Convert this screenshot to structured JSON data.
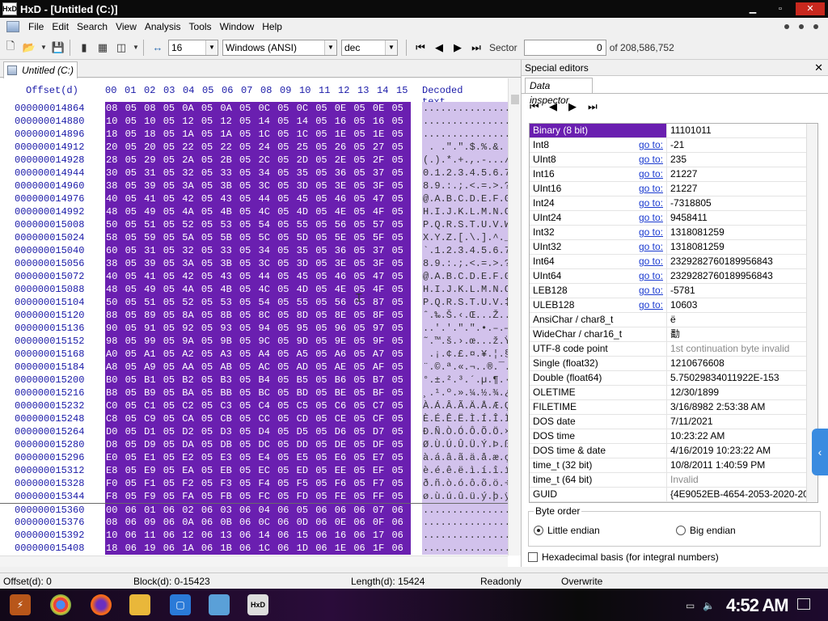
{
  "window": {
    "title": "HxD - [Untitled (C:)]",
    "app_icon_text": "HxD"
  },
  "menu": [
    "File",
    "Edit",
    "Search",
    "View",
    "Analysis",
    "Tools",
    "Window",
    "Help"
  ],
  "toolbar": {
    "bytes_per_row": "16",
    "charset": "Windows (ANSI)",
    "offset_base": "dec",
    "sector_label": "Sector",
    "sector_value": "0",
    "sector_total": "of 208,586,752"
  },
  "document_tab": "Untitled (C:)",
  "hex_header": {
    "offset": "Offset(d)",
    "columns": [
      "00",
      "01",
      "02",
      "03",
      "04",
      "05",
      "06",
      "07",
      "08",
      "09",
      "10",
      "11",
      "12",
      "13",
      "14",
      "15"
    ],
    "decoded": "Decoded text"
  },
  "hex_rows": [
    {
      "offset": "000000014864",
      "bytes": [
        "08",
        "05",
        "08",
        "05",
        "0A",
        "05",
        "0A",
        "05",
        "0C",
        "05",
        "0C",
        "05",
        "0E",
        "05",
        "0E",
        "05"
      ],
      "text": "................"
    },
    {
      "offset": "000000014880",
      "bytes": [
        "10",
        "05",
        "10",
        "05",
        "12",
        "05",
        "12",
        "05",
        "14",
        "05",
        "14",
        "05",
        "16",
        "05",
        "16",
        "05"
      ],
      "text": "................"
    },
    {
      "offset": "000000014896",
      "bytes": [
        "18",
        "05",
        "18",
        "05",
        "1A",
        "05",
        "1A",
        "05",
        "1C",
        "05",
        "1C",
        "05",
        "1E",
        "05",
        "1E",
        "05"
      ],
      "text": "................"
    },
    {
      "offset": "000000014912",
      "bytes": [
        "20",
        "05",
        "20",
        "05",
        "22",
        "05",
        "22",
        "05",
        "24",
        "05",
        "25",
        "05",
        "26",
        "05",
        "27",
        "05"
      ],
      "text": " . .\".\".$.%.&."
    },
    {
      "offset": "000000014928",
      "bytes": [
        "28",
        "05",
        "29",
        "05",
        "2A",
        "05",
        "2B",
        "05",
        "2C",
        "05",
        "2D",
        "05",
        "2E",
        "05",
        "2F",
        "05"
      ],
      "text": "(.).*.+.,.-.../."
    },
    {
      "offset": "000000014944",
      "bytes": [
        "30",
        "05",
        "31",
        "05",
        "32",
        "05",
        "33",
        "05",
        "34",
        "05",
        "35",
        "05",
        "36",
        "05",
        "37",
        "05"
      ],
      "text": "0.1.2.3.4.5.6.7."
    },
    {
      "offset": "000000014960",
      "bytes": [
        "38",
        "05",
        "39",
        "05",
        "3A",
        "05",
        "3B",
        "05",
        "3C",
        "05",
        "3D",
        "05",
        "3E",
        "05",
        "3F",
        "05"
      ],
      "text": "8.9.:.;.<.=.>.?."
    },
    {
      "offset": "000000014976",
      "bytes": [
        "40",
        "05",
        "41",
        "05",
        "42",
        "05",
        "43",
        "05",
        "44",
        "05",
        "45",
        "05",
        "46",
        "05",
        "47",
        "05"
      ],
      "text": "@.A.B.C.D.E.F.G."
    },
    {
      "offset": "000000014992",
      "bytes": [
        "48",
        "05",
        "49",
        "05",
        "4A",
        "05",
        "4B",
        "05",
        "4C",
        "05",
        "4D",
        "05",
        "4E",
        "05",
        "4F",
        "05"
      ],
      "text": "H.I.J.K.L.M.N.O."
    },
    {
      "offset": "000000015008",
      "bytes": [
        "50",
        "05",
        "51",
        "05",
        "52",
        "05",
        "53",
        "05",
        "54",
        "05",
        "55",
        "05",
        "56",
        "05",
        "57",
        "05"
      ],
      "text": "P.Q.R.S.T.U.V.W."
    },
    {
      "offset": "000000015024",
      "bytes": [
        "58",
        "05",
        "59",
        "05",
        "5A",
        "05",
        "5B",
        "05",
        "5C",
        "05",
        "5D",
        "05",
        "5E",
        "05",
        "5F",
        "05"
      ],
      "text": "X.Y.Z.[.\\.].^._."
    },
    {
      "offset": "000000015040",
      "bytes": [
        "60",
        "05",
        "31",
        "05",
        "32",
        "05",
        "33",
        "05",
        "34",
        "05",
        "35",
        "05",
        "36",
        "05",
        "37",
        "05"
      ],
      "text": "`.1.2.3.4.5.6.7."
    },
    {
      "offset": "000000015056",
      "bytes": [
        "38",
        "05",
        "39",
        "05",
        "3A",
        "05",
        "3B",
        "05",
        "3C",
        "05",
        "3D",
        "05",
        "3E",
        "05",
        "3F",
        "05"
      ],
      "text": "8.9.:.;.<.=.>.?."
    },
    {
      "offset": "000000015072",
      "bytes": [
        "40",
        "05",
        "41",
        "05",
        "42",
        "05",
        "43",
        "05",
        "44",
        "05",
        "45",
        "05",
        "46",
        "05",
        "47",
        "05"
      ],
      "text": "@.A.B.C.D.E.F.G."
    },
    {
      "offset": "000000015088",
      "bytes": [
        "48",
        "05",
        "49",
        "05",
        "4A",
        "05",
        "4B",
        "05",
        "4C",
        "05",
        "4D",
        "05",
        "4E",
        "05",
        "4F",
        "05"
      ],
      "text": "H.I.J.K.L.M.N.O."
    },
    {
      "offset": "000000015104",
      "bytes": [
        "50",
        "05",
        "51",
        "05",
        "52",
        "05",
        "53",
        "05",
        "54",
        "05",
        "55",
        "05",
        "56",
        "05",
        "87",
        "05"
      ],
      "text": "P.Q.R.S.T.U.V.‡."
    },
    {
      "offset": "000000015120",
      "bytes": [
        "88",
        "05",
        "89",
        "05",
        "8A",
        "05",
        "8B",
        "05",
        "8C",
        "05",
        "8D",
        "05",
        "8E",
        "05",
        "8F",
        "05"
      ],
      "text": "ˆ.‰.Š.‹.Œ...Ž..."
    },
    {
      "offset": "000000015136",
      "bytes": [
        "90",
        "05",
        "91",
        "05",
        "92",
        "05",
        "93",
        "05",
        "94",
        "05",
        "95",
        "05",
        "96",
        "05",
        "97",
        "05"
      ],
      "text": "..'.'.\".\".•.–.—."
    },
    {
      "offset": "000000015152",
      "bytes": [
        "98",
        "05",
        "99",
        "05",
        "9A",
        "05",
        "9B",
        "05",
        "9C",
        "05",
        "9D",
        "05",
        "9E",
        "05",
        "9F",
        "05"
      ],
      "text": "˜.™.š.›.œ...ž.Ÿ."
    },
    {
      "offset": "000000015168",
      "bytes": [
        "A0",
        "05",
        "A1",
        "05",
        "A2",
        "05",
        "A3",
        "05",
        "A4",
        "05",
        "A5",
        "05",
        "A6",
        "05",
        "A7",
        "05"
      ],
      "text": " .¡.¢.£.¤.¥.¦.§."
    },
    {
      "offset": "000000015184",
      "bytes": [
        "A8",
        "05",
        "A9",
        "05",
        "AA",
        "05",
        "AB",
        "05",
        "AC",
        "05",
        "AD",
        "05",
        "AE",
        "05",
        "AF",
        "05"
      ],
      "text": "¨.©.ª.«.¬.­.®.¯."
    },
    {
      "offset": "000000015200",
      "bytes": [
        "B0",
        "05",
        "B1",
        "05",
        "B2",
        "05",
        "B3",
        "05",
        "B4",
        "05",
        "B5",
        "05",
        "B6",
        "05",
        "B7",
        "05"
      ],
      "text": "°.±.².³.´.µ.¶.·."
    },
    {
      "offset": "000000015216",
      "bytes": [
        "B8",
        "05",
        "B9",
        "05",
        "BA",
        "05",
        "BB",
        "05",
        "BC",
        "05",
        "BD",
        "05",
        "BE",
        "05",
        "BF",
        "05"
      ],
      "text": "¸.¹.º.».¼.½.¾.¿."
    },
    {
      "offset": "000000015232",
      "bytes": [
        "C0",
        "05",
        "C1",
        "05",
        "C2",
        "05",
        "C3",
        "05",
        "C4",
        "05",
        "C5",
        "05",
        "C6",
        "05",
        "C7",
        "05"
      ],
      "text": "À.Á.Â.Ã.Ä.Å.Æ.Ç."
    },
    {
      "offset": "000000015248",
      "bytes": [
        "C8",
        "05",
        "C9",
        "05",
        "CA",
        "05",
        "CB",
        "05",
        "CC",
        "05",
        "CD",
        "05",
        "CE",
        "05",
        "CF",
        "05"
      ],
      "text": "È.É.Ê.Ë.Ì.Í.Î.Ï."
    },
    {
      "offset": "000000015264",
      "bytes": [
        "D0",
        "05",
        "D1",
        "05",
        "D2",
        "05",
        "D3",
        "05",
        "D4",
        "05",
        "D5",
        "05",
        "D6",
        "05",
        "D7",
        "05"
      ],
      "text": "Ð.Ñ.Ò.Ó.Ô.Õ.Ö.×."
    },
    {
      "offset": "000000015280",
      "bytes": [
        "D8",
        "05",
        "D9",
        "05",
        "DA",
        "05",
        "DB",
        "05",
        "DC",
        "05",
        "DD",
        "05",
        "DE",
        "05",
        "DF",
        "05"
      ],
      "text": "Ø.Ù.Ú.Û.Ü.Ý.Þ.ß."
    },
    {
      "offset": "000000015296",
      "bytes": [
        "E0",
        "05",
        "E1",
        "05",
        "E2",
        "05",
        "E3",
        "05",
        "E4",
        "05",
        "E5",
        "05",
        "E6",
        "05",
        "E7",
        "05"
      ],
      "text": "à.á.â.ã.ä.å.æ.ç."
    },
    {
      "offset": "000000015312",
      "bytes": [
        "E8",
        "05",
        "E9",
        "05",
        "EA",
        "05",
        "EB",
        "05",
        "EC",
        "05",
        "ED",
        "05",
        "EE",
        "05",
        "EF",
        "05"
      ],
      "text": "è.é.ê.ë.ì.í.î.ï."
    },
    {
      "offset": "000000015328",
      "bytes": [
        "F0",
        "05",
        "F1",
        "05",
        "F2",
        "05",
        "F3",
        "05",
        "F4",
        "05",
        "F5",
        "05",
        "F6",
        "05",
        "F7",
        "05"
      ],
      "text": "ð.ñ.ò.ó.ô.õ.ö.÷."
    },
    {
      "offset": "000000015344",
      "bytes": [
        "F8",
        "05",
        "F9",
        "05",
        "FA",
        "05",
        "FB",
        "05",
        "FC",
        "05",
        "FD",
        "05",
        "FE",
        "05",
        "FF",
        "05"
      ],
      "text": "ø.ù.ú.û.ü.ý.þ.ÿ."
    },
    {
      "offset": "000000015360",
      "bytes": [
        "00",
        "06",
        "01",
        "06",
        "02",
        "06",
        "03",
        "06",
        "04",
        "06",
        "05",
        "06",
        "06",
        "06",
        "07",
        "06"
      ],
      "text": "................"
    },
    {
      "offset": "000000015376",
      "bytes": [
        "08",
        "06",
        "09",
        "06",
        "0A",
        "06",
        "0B",
        "06",
        "0C",
        "06",
        "0D",
        "06",
        "0E",
        "06",
        "0F",
        "06"
      ],
      "text": "................"
    },
    {
      "offset": "000000015392",
      "bytes": [
        "10",
        "06",
        "11",
        "06",
        "12",
        "06",
        "13",
        "06",
        "14",
        "06",
        "15",
        "06",
        "16",
        "06",
        "17",
        "06"
      ],
      "text": "................"
    },
    {
      "offset": "000000015408",
      "bytes": [
        "18",
        "06",
        "19",
        "06",
        "1A",
        "06",
        "1B",
        "06",
        "1C",
        "06",
        "1D",
        "06",
        "1E",
        "06",
        "1F",
        "06"
      ],
      "text": "................"
    }
  ],
  "special_editors": {
    "title": "Special editors",
    "tab": "Data inspector",
    "goto_label": "go to:",
    "rows": [
      {
        "label": "Binary (8 bit)",
        "value": "11101011",
        "goto": false,
        "selected": true
      },
      {
        "label": "Int8",
        "value": "-21",
        "goto": true
      },
      {
        "label": "UInt8",
        "value": "235",
        "goto": true
      },
      {
        "label": "Int16",
        "value": "21227",
        "goto": true
      },
      {
        "label": "UInt16",
        "value": "21227",
        "goto": true
      },
      {
        "label": "Int24",
        "value": "-7318805",
        "goto": true
      },
      {
        "label": "UInt24",
        "value": "9458411",
        "goto": true
      },
      {
        "label": "Int32",
        "value": "1318081259",
        "goto": true
      },
      {
        "label": "UInt32",
        "value": "1318081259",
        "goto": true
      },
      {
        "label": "Int64",
        "value": "2329282760189956843",
        "goto": true
      },
      {
        "label": "UInt64",
        "value": "2329282760189956843",
        "goto": true
      },
      {
        "label": "LEB128",
        "value": "-5781",
        "goto": true
      },
      {
        "label": "ULEB128",
        "value": "10603",
        "goto": true
      },
      {
        "label": "AnsiChar / char8_t",
        "value": "ë",
        "goto": false
      },
      {
        "label": "WideChar / char16_t",
        "value": "勫",
        "goto": false
      },
      {
        "label": "UTF-8 code point",
        "value": "1st continuation byte invalid",
        "goto": false,
        "dim": true
      },
      {
        "label": "Single (float32)",
        "value": "1210676608",
        "goto": false
      },
      {
        "label": "Double (float64)",
        "value": "5.75029834011922E-153",
        "goto": false
      },
      {
        "label": "OLETIME",
        "value": "12/30/1899",
        "goto": false
      },
      {
        "label": "FILETIME",
        "value": "3/16/8982 2:53:38 AM",
        "goto": false
      },
      {
        "label": "DOS date",
        "value": "7/11/2021",
        "goto": false
      },
      {
        "label": "DOS time",
        "value": "10:23:22 AM",
        "goto": false
      },
      {
        "label": "DOS time & date",
        "value": "4/16/2019 10:23:22 AM",
        "goto": false
      },
      {
        "label": "time_t (32 bit)",
        "value": "10/8/2011 1:40:59 PM",
        "goto": false
      },
      {
        "label": "time_t (64 bit)",
        "value": "Invalid",
        "goto": false,
        "dim": true
      },
      {
        "label": "GUID",
        "value": "{4E9052EB-4654-2053-2020-2000",
        "goto": false
      }
    ],
    "byte_order": {
      "legend": "Byte order",
      "little": "Little endian",
      "big": "Big endian",
      "selected": "little"
    },
    "hex_basis_label": "Hexadecimal basis (for integral numbers)",
    "hex_basis_checked": false
  },
  "status": {
    "offset": "Offset(d): 0",
    "block": "Block(d): 0-15423",
    "length": "Length(d): 15424",
    "mode": "Readonly",
    "insert": "Overwrite"
  },
  "taskbar": {
    "clock": "4:52 AM"
  },
  "colors": {
    "selection": "#6a1fb0",
    "decoded_bg": "#d2c2ec",
    "offset_text": "#1a1aa8",
    "link": "#1a3ad0"
  }
}
